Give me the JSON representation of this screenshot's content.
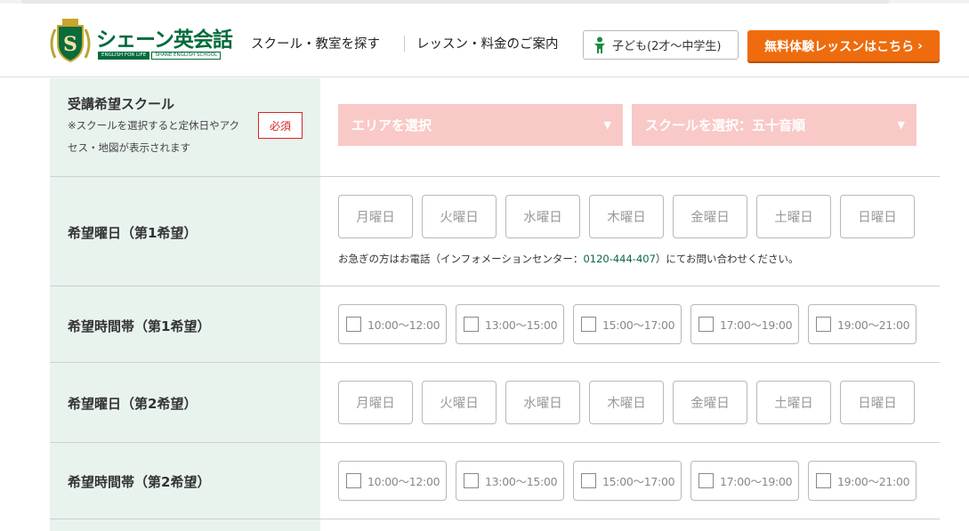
{
  "header": {
    "logo_text": "シェーン英会話",
    "logo_tag1": "ENGLISH FOR LIFE",
    "logo_tag2": "SHANE ENGLISH SCHOOL",
    "nav_school": "スクール・教室を探す",
    "nav_lesson": "レッスン・料金のご案内",
    "kids_label": "子ども(2才〜中学生)",
    "trial_label": "無料体験レッスンはこちら",
    "colors": {
      "brand_green": "#006b3a",
      "cta_orange": "#ee6c0e"
    }
  },
  "form": {
    "school": {
      "title": "受講希望スクール",
      "note": "※スクールを選択すると定休日やアクセス・地図が表示されます",
      "required": "必須",
      "area_select": "エリアを選択",
      "school_select": "スクールを選択：五十音順"
    },
    "day1": {
      "title": "希望曜日（第1希望）"
    },
    "time1": {
      "title": "希望時間帯（第1希望）"
    },
    "day2": {
      "title": "希望曜日（第2希望）"
    },
    "time2": {
      "title": "希望時間帯（第2希望）"
    },
    "help": {
      "before": "お急ぎの方はお電話（インフォメーションセンター：",
      "tel": "0120-444-407",
      "after": "）にてお問い合わせください。"
    },
    "days": [
      "月曜日",
      "火曜日",
      "水曜日",
      "木曜日",
      "金曜日",
      "土曜日",
      "日曜日"
    ],
    "times": [
      "10:00〜12:00",
      "13:00〜15:00",
      "15:00〜17:00",
      "17:00〜19:00",
      "19:00〜21:00"
    ]
  }
}
